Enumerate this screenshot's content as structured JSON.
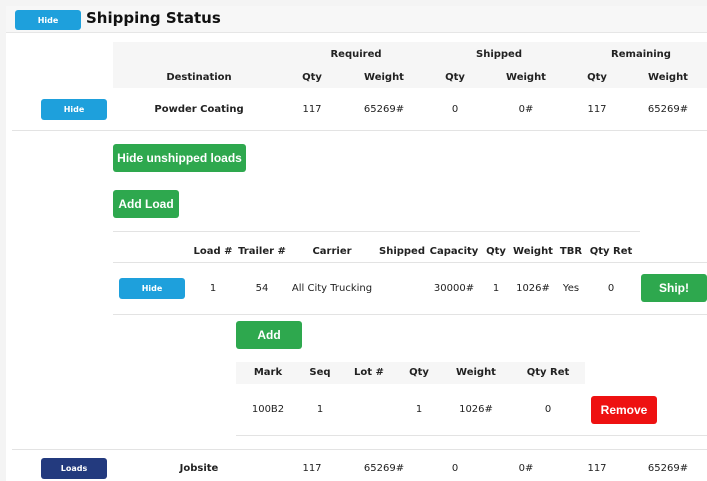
{
  "header": {
    "hide_label": "Hide",
    "title": "Shipping Status"
  },
  "destinations": {
    "group_headers": {
      "required": "Required",
      "shipped": "Shipped",
      "remaining": "Remaining"
    },
    "columns": {
      "destination": "Destination",
      "req_qty": "Qty",
      "req_weight": "Weight",
      "shp_qty": "Qty",
      "shp_weight": "Weight",
      "rem_qty": "Qty",
      "rem_weight": "Weight"
    },
    "rows": [
      {
        "button": "Hide",
        "destination": "Powder Coating",
        "req_qty": "117",
        "req_weight": "65269#",
        "shp_qty": "0",
        "shp_weight": "0#",
        "rem_qty": "117",
        "rem_weight": "65269#"
      },
      {
        "button": "Loads",
        "destination": "Jobsite",
        "req_qty": "117",
        "req_weight": "65269#",
        "shp_qty": "0",
        "shp_weight": "0#",
        "rem_qty": "117",
        "rem_weight": "65269#"
      }
    ]
  },
  "actions": {
    "hide_unshipped": "Hide unshipped loads",
    "add_load": "Add Load"
  },
  "loads": {
    "columns": {
      "load_no": "Load #",
      "trailer_no": "Trailer #",
      "carrier": "Carrier",
      "shipped": "Shipped",
      "capacity": "Capacity",
      "qty": "Qty",
      "weight": "Weight",
      "tbr": "TBR",
      "qty_ret": "Qty Ret"
    },
    "rows": [
      {
        "button": "Hide",
        "load_no": "1",
        "trailer_no": "54",
        "carrier": "All City Trucking",
        "shipped": "",
        "capacity": "30000#",
        "qty": "1",
        "weight": "1026#",
        "tbr": "Yes",
        "qty_ret": "0",
        "ship_label": "Ship!"
      }
    ]
  },
  "items": {
    "add_label": "Add",
    "columns": {
      "mark": "Mark",
      "seq": "Seq",
      "lot_no": "Lot #",
      "qty": "Qty",
      "weight": "Weight",
      "qty_ret": "Qty Ret"
    },
    "rows": [
      {
        "mark": "100B2",
        "seq": "1",
        "lot_no": "",
        "qty": "1",
        "weight": "1026#",
        "qty_ret": "0",
        "remove_label": "Remove"
      }
    ]
  },
  "colors": {
    "blue_button": "#1ea0dc",
    "navy_button": "#233a7e",
    "green_button": "#2ea84e",
    "red_button": "#ee1111"
  }
}
